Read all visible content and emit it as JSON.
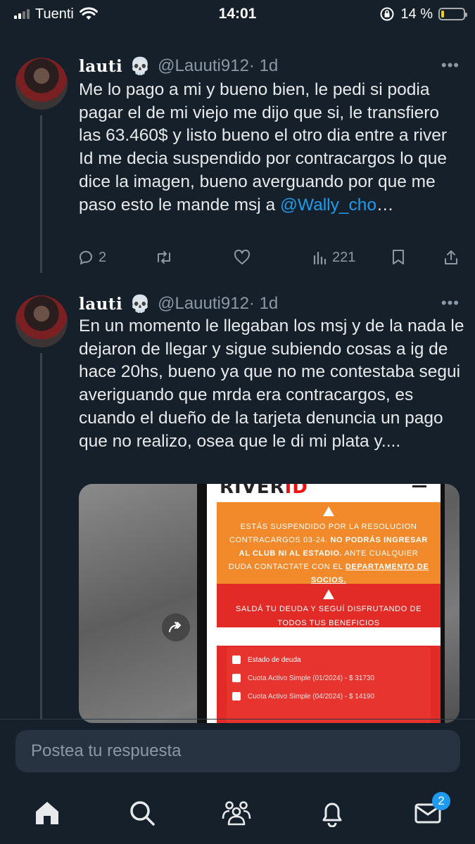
{
  "status_bar": {
    "carrier": "Tuenti",
    "time": "14:01",
    "battery_percent": "14 %",
    "battery_level": 0.14
  },
  "tweets": [
    {
      "display_name": "lauti",
      "emoji": "💀",
      "handle": "@Lauuti912",
      "time": "· 1d",
      "text": "Me lo pago a mi y bueno bien, le pedi si podia pagar el de mi viejo me dijo que si, le transfiero las 63.460$ y listo bueno el otro dia entre a river Id me decia suspendido por contracargos lo que dice la imagen, bueno averguando por que me paso esto le mande msj a ",
      "mention": "@Wally_cho",
      "ellipsis": "…",
      "replies": "2",
      "views": "221"
    },
    {
      "display_name": "lauti",
      "emoji": "💀",
      "handle": "@Lauuti912",
      "time": "· 1d",
      "text": "En un momento le llegaban los msj y de la nada le dejaron de llegar y sigue subiendo cosas a ig de hace 20hs, bueno ya que no me contestaba segui averiguando que mrda era contracargos, es cuando el dueño de la tarjeta denuncia un pago que no realizo, osea que le di mi plata y...."
    }
  ],
  "media": {
    "logo_text": "RIVER",
    "logo_id": "ID",
    "warning_pre": "ESTÁS SUSPENDIDO POR LA RESOLUCION CONTRACARGOS 03-24. ",
    "warning_bold": "NO PODRÁS INGRESAR AL CLUB NI AL ESTADIO.",
    "warning_post": " ANTE CUALQUIER DUDA CONTACTATE CON EL ",
    "warning_link": "DEPARTAMENTO DE SOCIOS.",
    "debt_title": "SALDÁ TU DEUDA Y SEGUÍ DISFRUTANDO DE TODOS TUS BENEFICIOS",
    "list_items": [
      "Estado de deuda",
      "Cuota Activo Simple (01/2024) - $ 31730",
      "Cuota Activo Simple (04/2024) - $ 14190"
    ]
  },
  "reply": {
    "placeholder": "Postea tu respuesta"
  },
  "tabbar": {
    "messages_badge": "2"
  }
}
